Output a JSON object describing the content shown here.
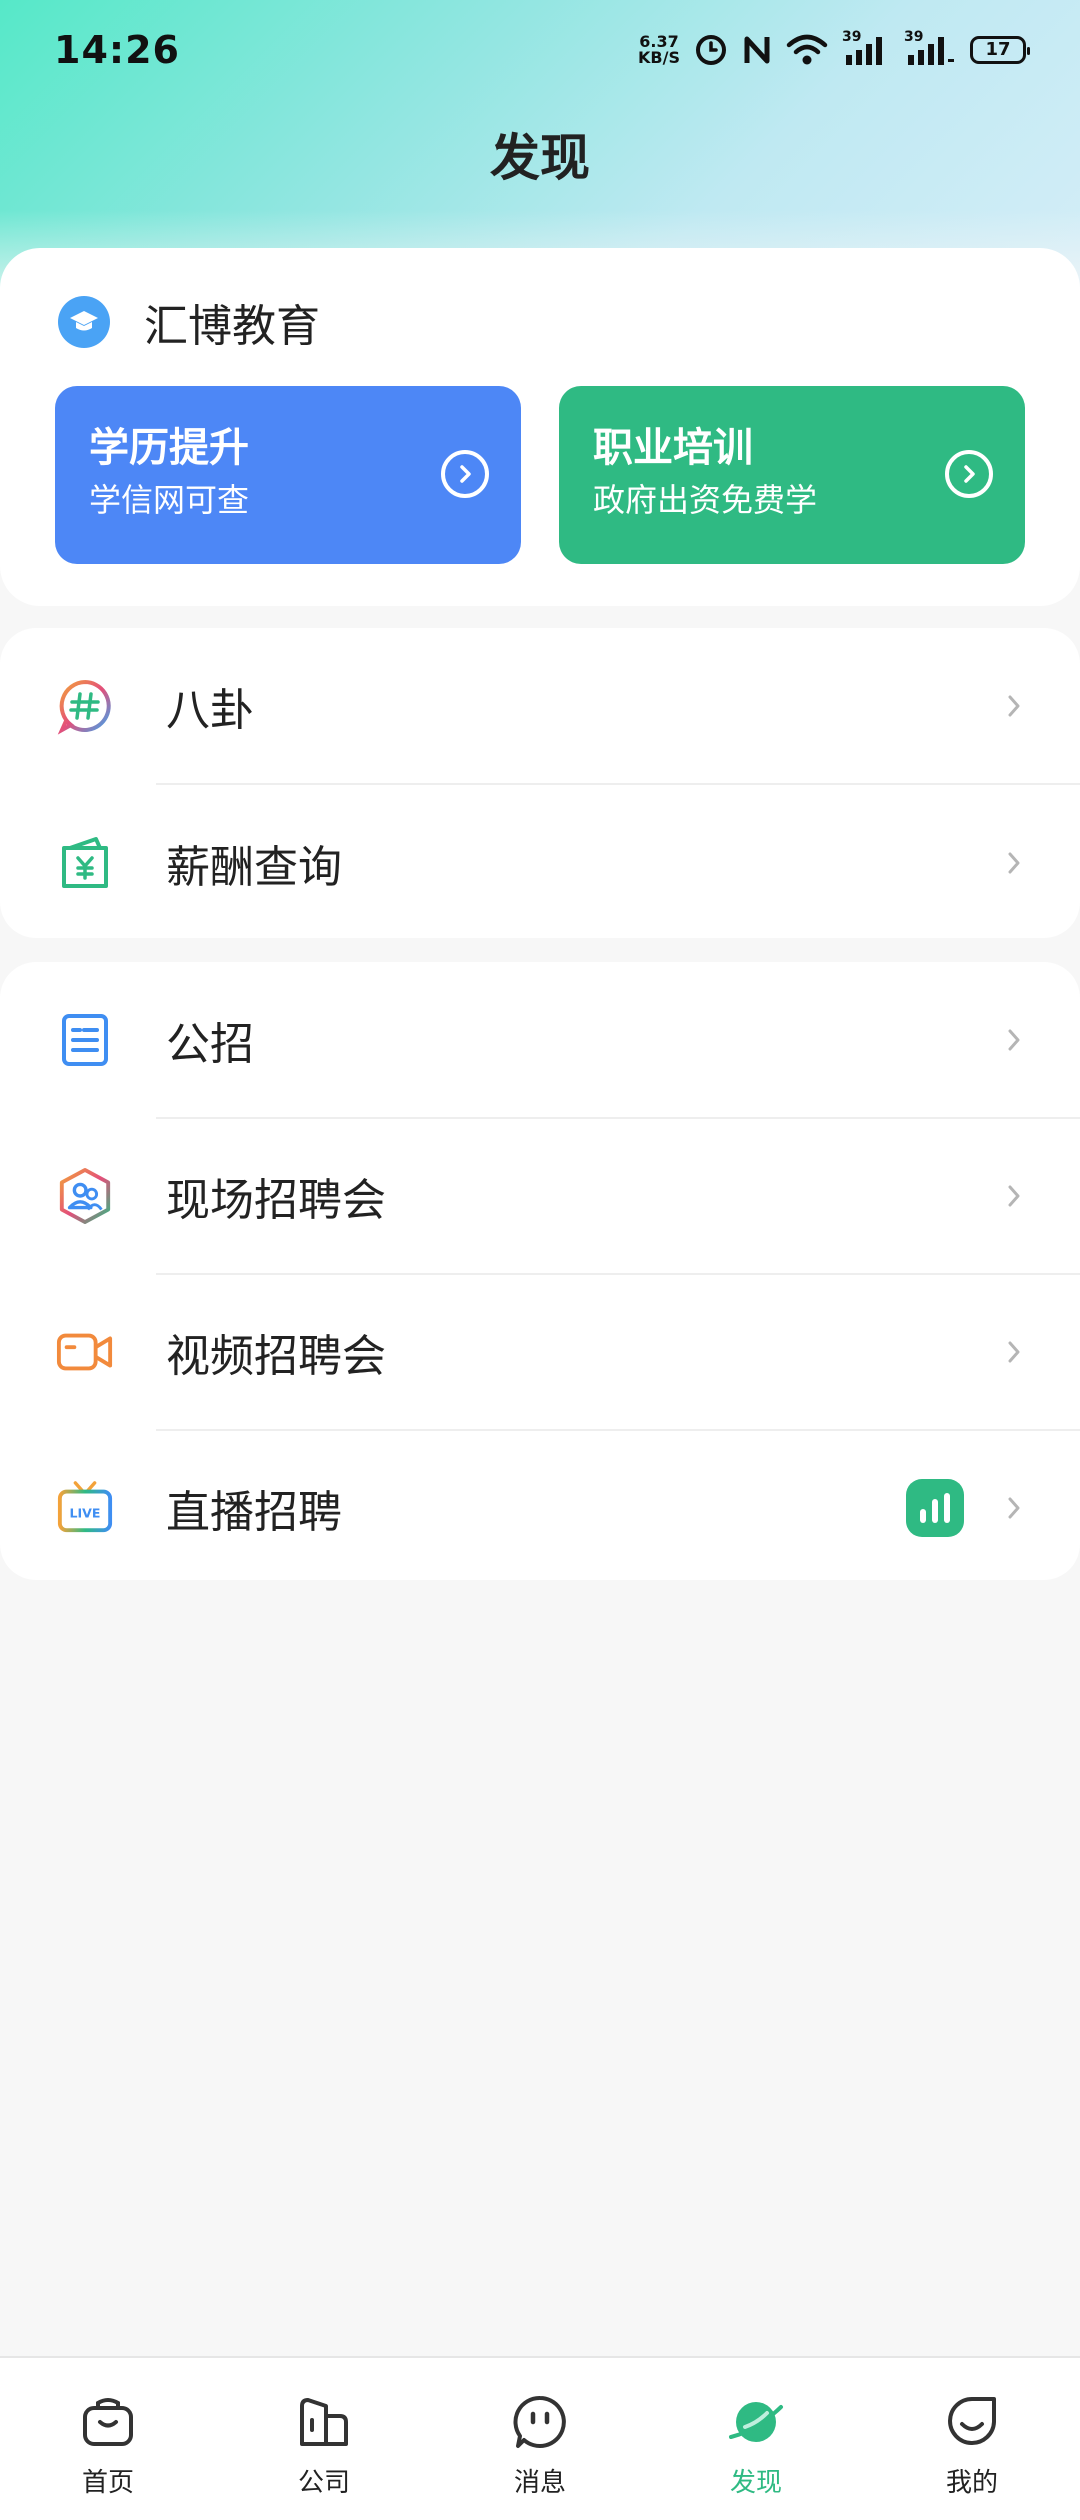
{
  "status_bar": {
    "time": "14:26",
    "net_speed_value": "6.37",
    "net_speed_unit": "KB/S",
    "signal1_label": "39",
    "signal2_label": "39",
    "battery": "17"
  },
  "page_title": "发现",
  "education": {
    "title": "汇博教育",
    "promos": [
      {
        "title": "学历提升",
        "subtitle": "学信网可查",
        "color": "#4d87f6"
      },
      {
        "title": "职业培训",
        "subtitle": "政府出资免费学",
        "color": "#2fba83"
      }
    ]
  },
  "section_a": {
    "items": [
      {
        "label": "八卦",
        "icon": "gossip-hashtag-icon"
      },
      {
        "label": "薪酬查询",
        "icon": "salary-wallet-icon"
      }
    ]
  },
  "section_b": {
    "items": [
      {
        "label": "公招",
        "icon": "document-icon"
      },
      {
        "label": "现场招聘会",
        "icon": "people-hexagon-icon"
      },
      {
        "label": "视频招聘会",
        "icon": "video-camera-icon"
      },
      {
        "label": "直播招聘",
        "icon": "live-tv-icon"
      }
    ]
  },
  "tabbar": {
    "tabs": [
      {
        "label": "首页",
        "icon": "bag-icon"
      },
      {
        "label": "公司",
        "icon": "building-icon"
      },
      {
        "label": "消息",
        "icon": "chat-bubble-icon"
      },
      {
        "label": "发现",
        "icon": "planet-icon",
        "active": true
      },
      {
        "label": "我的",
        "icon": "smile-face-icon"
      }
    ],
    "active_color": "#2fba83"
  }
}
